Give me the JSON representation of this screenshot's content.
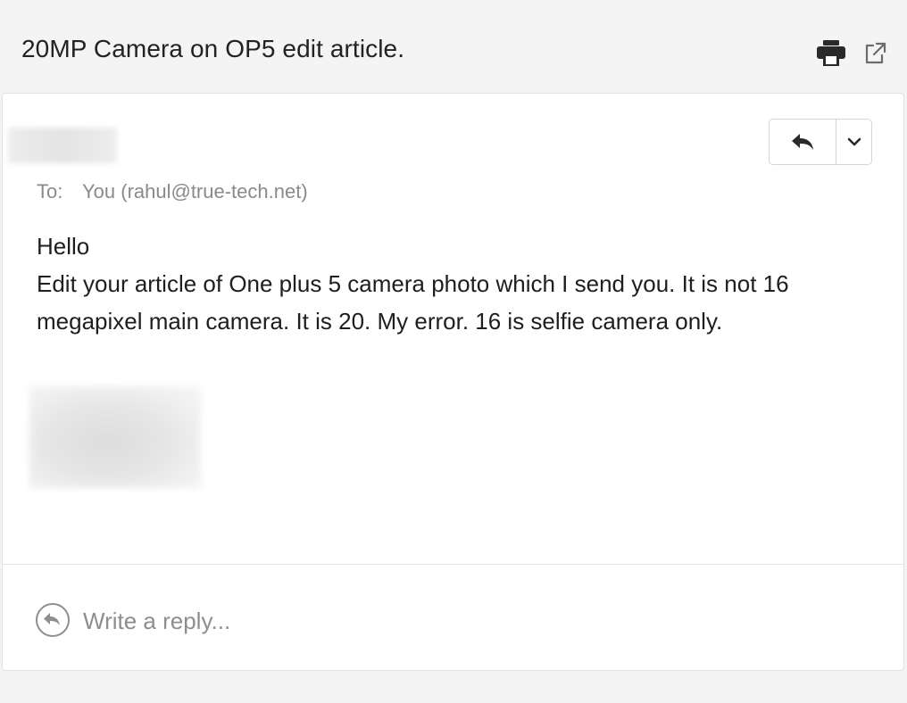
{
  "header": {
    "subject": "20MP Camera on OP5 edit article.",
    "print_icon": "print-icon",
    "popout_icon": "popout-icon"
  },
  "message": {
    "to_label": "To:",
    "to_value": "You (rahul@true-tech.net)",
    "body_lines": [
      "Hello",
      "Edit your article of One plus 5 camera photo which I send you. It is not 16",
      "megapixel main camera. It is 20. My error. 16 is selfie camera only."
    ],
    "reply_icon": "reply-arrow-icon",
    "menu_icon": "chevron-down-icon"
  },
  "reply_box": {
    "placeholder": "Write a reply...",
    "icon": "reply-circle-icon"
  },
  "colors": {
    "page_background": "#f4f4f4",
    "card_background": "#ffffff",
    "muted_text": "#8a8a8a",
    "icon_dark": "#2a2a2a"
  }
}
